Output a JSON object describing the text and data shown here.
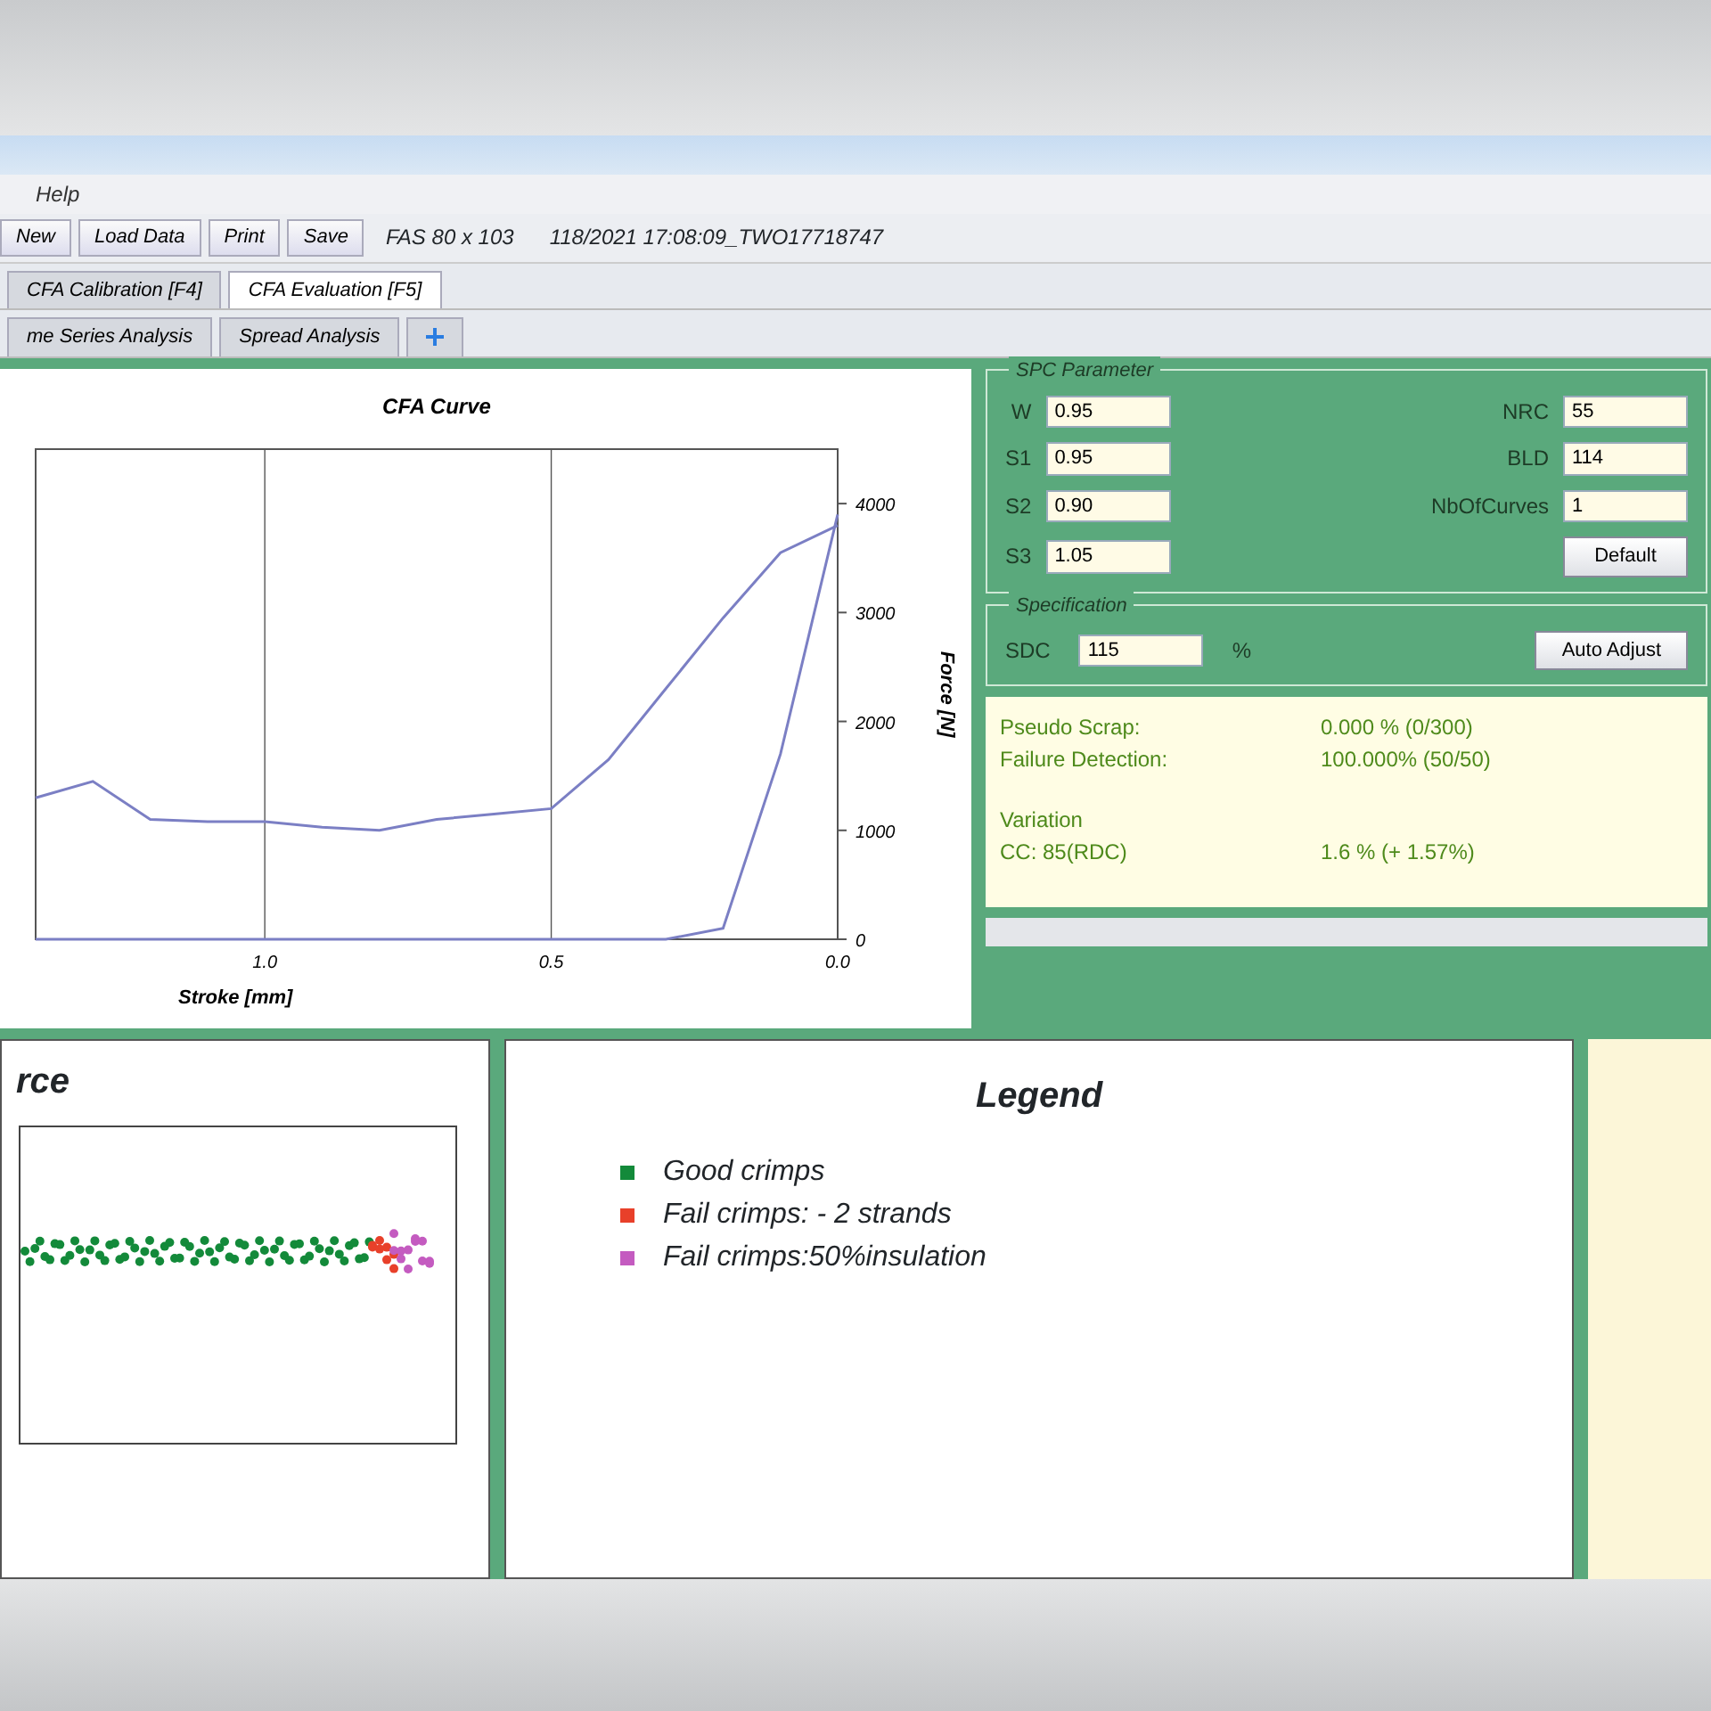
{
  "menu": [
    {
      "label": "Help"
    }
  ],
  "toolbar": {
    "buttons": [
      {
        "label": "New"
      },
      {
        "label": "Load Data"
      },
      {
        "label": "Print"
      },
      {
        "label": "Save"
      }
    ],
    "info": [
      "FAS 80 x 103",
      "118/2021 17:08:09_TWO17718747"
    ]
  },
  "tabs": [
    {
      "label": "CFA Calibration [F4]",
      "selected": false
    },
    {
      "label": "CFA Evaluation [F5]",
      "selected": true
    }
  ],
  "subtabs": [
    {
      "label": "me Series Analysis",
      "selected": false
    },
    {
      "label": "Spread Analysis",
      "selected": false
    }
  ],
  "curve_chart": {
    "chart_data": {
      "type": "line",
      "title": "CFA Curve",
      "xlabel": "Stroke [mm]",
      "ylabel": "Force [N]",
      "x": [
        1.4,
        1.3,
        1.2,
        1.1,
        1.0,
        0.9,
        0.8,
        0.7,
        0.6,
        0.5,
        0.4,
        0.3,
        0.2,
        0.1,
        0.0
      ],
      "xlim": [
        1.4,
        0.0
      ],
      "ylim": [
        0,
        4500
      ],
      "xticks": [
        {
          "value": 1.0,
          "label": "1.0"
        },
        {
          "value": 0.5,
          "label": "0.5"
        },
        {
          "value": 0.0,
          "label": "0.0"
        }
      ],
      "yticks": [
        0,
        1000,
        2000,
        3000,
        4000
      ],
      "series": [
        {
          "color": "#7b7fc4",
          "values": [
            1300,
            1450,
            1100,
            1080,
            1080,
            1030,
            1000,
            1100,
            1150,
            1200,
            1650,
            2300,
            2950,
            3550,
            3800
          ]
        },
        {
          "color": "#7b7fc4",
          "values": [
            0,
            0,
            0,
            0,
            0,
            0,
            0,
            0,
            0,
            0,
            0,
            0,
            100,
            1700,
            3900
          ]
        }
      ]
    }
  },
  "parameters": {
    "title": "SPC Parameter",
    "fields": [
      {
        "label": "W",
        "value": "0.95"
      },
      {
        "label": "S1",
        "value": "0.95"
      },
      {
        "label": "S2",
        "value": "0.90"
      },
      {
        "label": "S3",
        "value": "1.05"
      },
      {
        "label": "NRC",
        "value": "55"
      },
      {
        "label": "BLD",
        "value": "114"
      },
      {
        "label": "NbOfCurves",
        "value": "1"
      }
    ],
    "button": "Default"
  },
  "specification": {
    "title": "Specification",
    "label": "SDC",
    "value": "115",
    "unit": "%",
    "button": "Auto Adjust"
  },
  "results": [
    {
      "label": "Pseudo Scrap:",
      "value": "0.000 % (0/300)"
    },
    {
      "label": "Failure Detection:",
      "value": "100.000% (50/50)"
    },
    {
      "label": "Variation"
    },
    {
      "label": "CC: 85(RDC)",
      "value": "1.6 %  (+ 1.57%)"
    }
  ],
  "scatter_panel": {
    "title": "rce"
  },
  "legend": {
    "title": "Legend",
    "items": [
      {
        "label": "Good crimps",
        "color": "#138a3a"
      },
      {
        "label": "Fail crimps: - 2 strands",
        "color": "#e8402a"
      },
      {
        "label": "Fail crimps:50%insulation",
        "color": "#c45bc0"
      }
    ]
  }
}
